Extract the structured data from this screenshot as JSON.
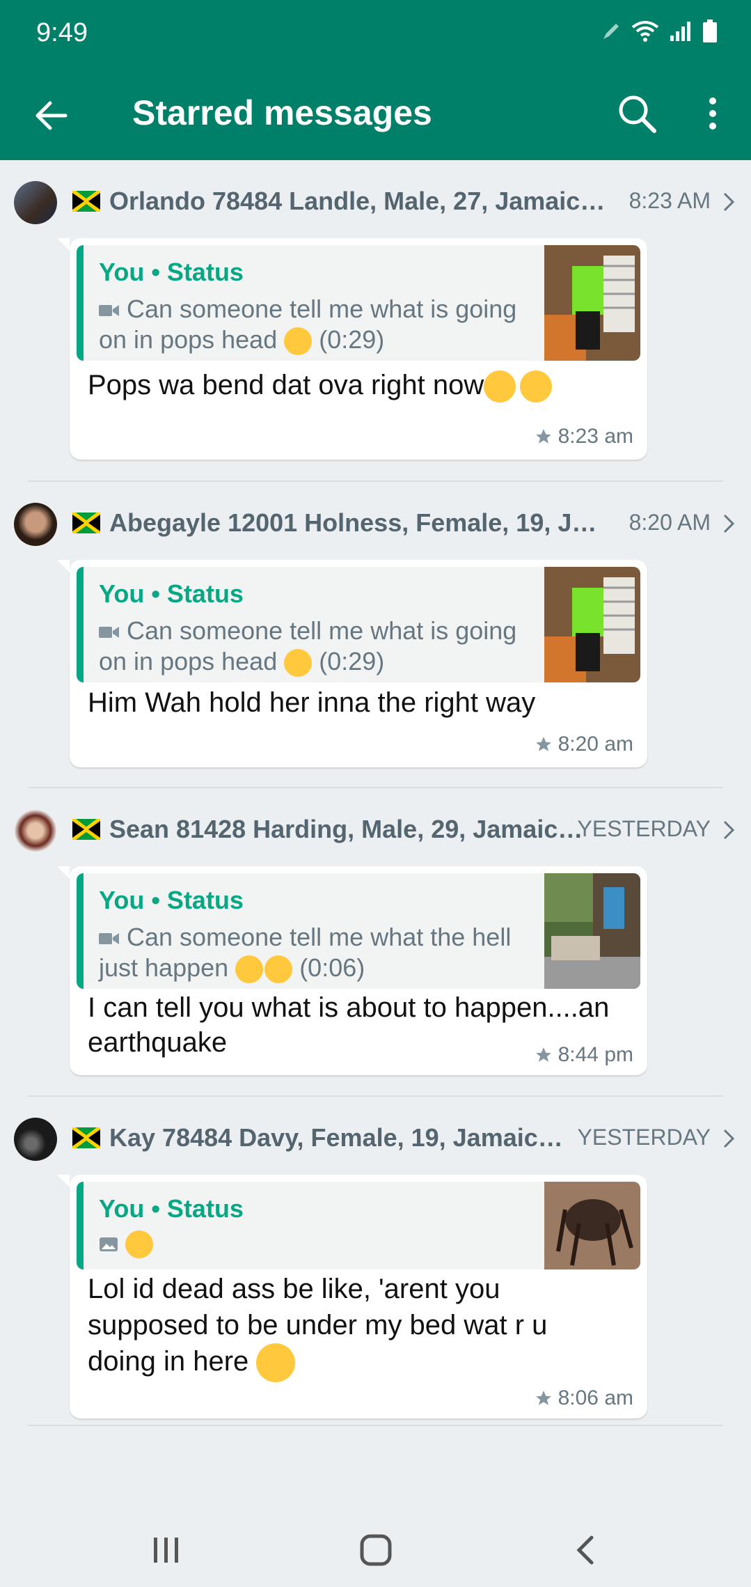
{
  "status_bar": {
    "time": "9:49"
  },
  "app_bar": {
    "title": "Starred messages"
  },
  "items": [
    {
      "sender": "Orlando 78484 Landle, Male, 27, Jamaica,...",
      "header_time": "8:23 AM",
      "quote_who": "You • Status",
      "quote_text": "Can someone tell me what is going on in pops head",
      "quote_duration": "(0:29)",
      "message": "Pops wa bend dat ova right now",
      "time": "8:23 am"
    },
    {
      "sender": "Abegayle 12001 Holness, Female, 19, Jam...",
      "header_time": "8:20 AM",
      "quote_who": "You • Status",
      "quote_text": "Can someone tell me what is going on in pops head",
      "quote_duration": "(0:29)",
      "message": "Him Wah hold her inna the right way",
      "time": "8:20 am"
    },
    {
      "sender": "Sean 81428 Harding, Male, 29, Jamaica,...",
      "header_time": "YESTERDAY",
      "quote_who": "You • Status",
      "quote_text": "Can someone tell me what the hell just happen",
      "quote_duration": "(0:06)",
      "message": "I can tell you what is about to happen....an earthquake",
      "time": "8:44 pm"
    },
    {
      "sender": "Kay 78484 Davy, Female, 19, Jamaica,...",
      "header_time": "YESTERDAY",
      "quote_who": "You • Status",
      "quote_text": "",
      "quote_duration": "",
      "message": "Lol id dead ass be like, 'arent you supposed to be under my bed wat r u doing in here",
      "time": "8:06 am"
    }
  ],
  "colors": {
    "primary": "#008069",
    "accent": "#06A884"
  }
}
